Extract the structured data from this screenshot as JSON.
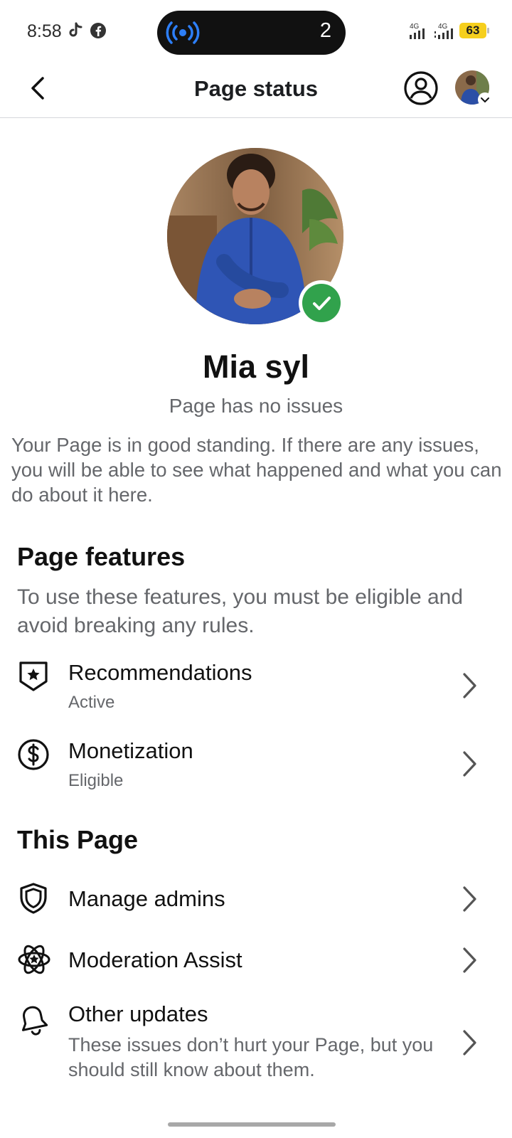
{
  "status_bar": {
    "time": "8:58",
    "notification_count": "2",
    "network_1": "4G",
    "network_2": "4G",
    "battery": "63"
  },
  "header": {
    "title": "Page status"
  },
  "profile": {
    "name": "Mia syl",
    "status": "Page has no issues",
    "description": "Your Page is in good standing. If there are any issues, you will be able to see what happened and what you can do about it here."
  },
  "page_features": {
    "title": "Page features",
    "description": "To use these features, you must be eligible and avoid breaking any rules.",
    "items": [
      {
        "label": "Recommendations",
        "status": "Active",
        "icon": "star-shield-icon"
      },
      {
        "label": "Monetization",
        "status": "Eligible",
        "icon": "dollar-circle-icon"
      }
    ]
  },
  "this_page": {
    "title": "This Page",
    "items": [
      {
        "label": "Manage admins",
        "icon": "shield-icon"
      },
      {
        "label": "Moderation Assist",
        "icon": "atom-star-icon"
      },
      {
        "label": "Other updates",
        "description": "These issues don’t hurt your Page, but you should still know about them.",
        "icon": "bell-icon"
      }
    ]
  },
  "colors": {
    "verified_green": "#31a24c",
    "secondary_text": "#65676b",
    "live_icon_blue": "#2d7ff9",
    "battery_yellow": "#f6cf1d"
  }
}
